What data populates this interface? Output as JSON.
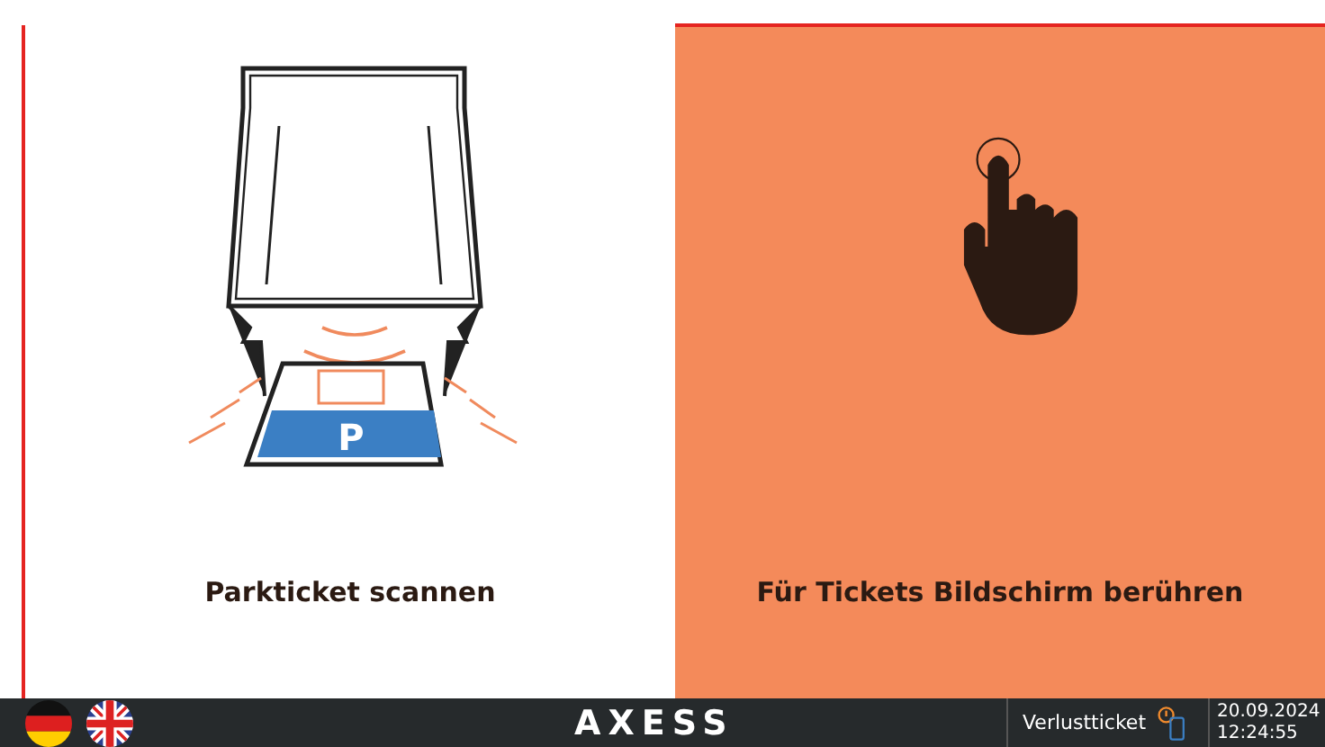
{
  "panels": [
    {
      "kind": "scan",
      "label": "Parkticket scannen",
      "ticket_sign": "P"
    },
    {
      "kind": "touch",
      "label": "Für Tickets Bildschirm berühren"
    }
  ],
  "bottom_bar": {
    "languages": [
      {
        "kind": "de"
      },
      {
        "kind": "en"
      }
    ],
    "logo": "AXESS",
    "lost_ticket": "Verlustticket",
    "date": "20.09.2024",
    "time": "12:24:55"
  }
}
